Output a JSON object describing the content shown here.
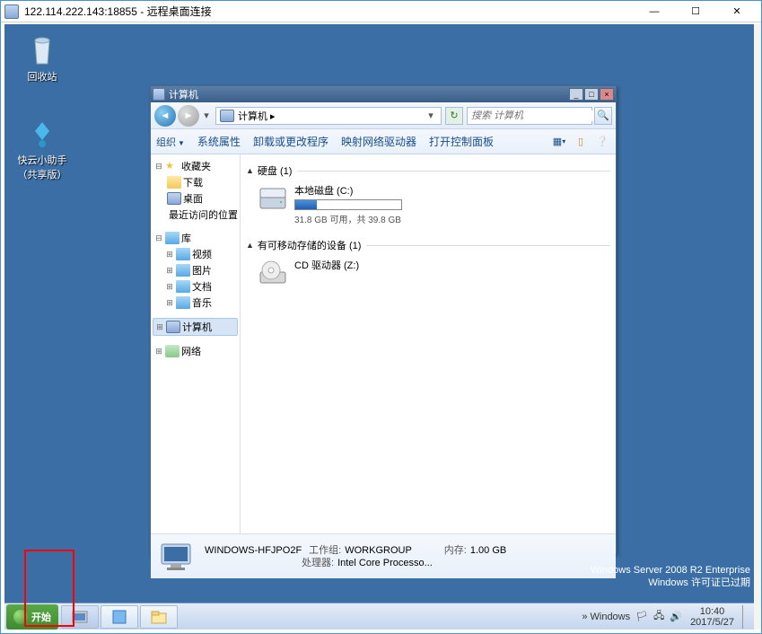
{
  "rdp": {
    "title": "122.114.222.143:18855 - 远程桌面连接"
  },
  "desktop": {
    "recycle": "回收站",
    "helper": "快云小助手（共享版）"
  },
  "watermark": {
    "line1": "Windows Server 2008 R2 Enterprise",
    "line2": "Windows 许可证已过期",
    "line3": ""
  },
  "taskbar": {
    "start": "开始",
    "tray_windows": "Windows",
    "clock_time": "10:40",
    "clock_date": "2017/5/27"
  },
  "explorer": {
    "title": "计算机",
    "breadcrumb": "计算机 ▸",
    "search_placeholder": "搜索 计算机",
    "toolbar": {
      "organize": "组织",
      "sysprops": "系统属性",
      "uninstall": "卸载或更改程序",
      "mapdrive": "映射网络驱动器",
      "controlpanel": "打开控制面板"
    },
    "tree": {
      "favorites": "收藏夹",
      "downloads": "下载",
      "desktop": "桌面",
      "recent": "最近访问的位置",
      "libraries": "库",
      "videos": "视频",
      "pictures": "图片",
      "documents": "文档",
      "music": "音乐",
      "computer": "计算机",
      "network": "网络"
    },
    "content": {
      "hdd_header": "硬盘 (1)",
      "local_disk": "本地磁盘 (C:)",
      "local_disk_space": "31.8 GB 可用，共 39.8 GB",
      "removable_header": "有可移动存储的设备 (1)",
      "cd_drive": "CD 驱动器 (Z:)"
    },
    "status": {
      "computer_name": "WINDOWS-HFJPO2F",
      "workgroup_label": "工作组:",
      "workgroup": "WORKGROUP",
      "memory_label": "内存:",
      "memory": "1.00 GB",
      "processor_label": "处理器:",
      "processor": "Intel Core Processo..."
    }
  }
}
